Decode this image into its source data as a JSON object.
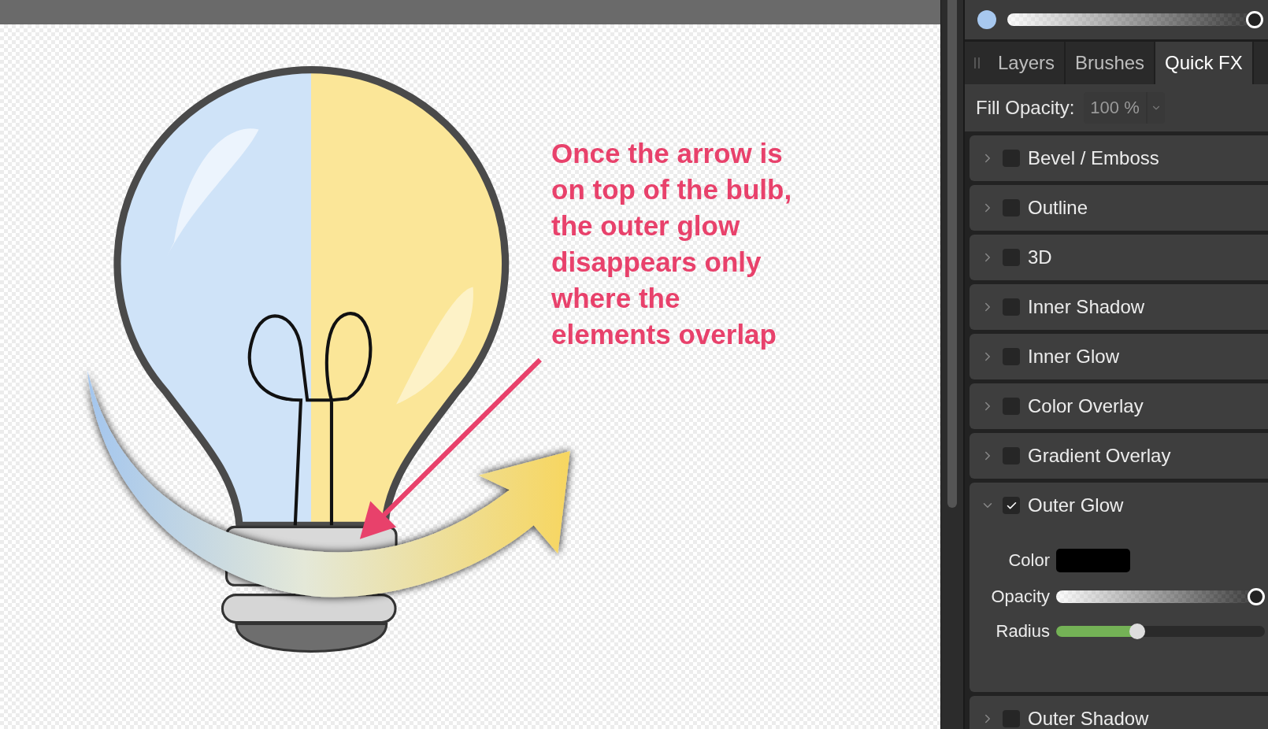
{
  "canvas": {
    "annotation": "Once the arrow is\non top of the bulb,\nthe outer glow\ndisappears only\nwhere the\nelements overlap"
  },
  "panel": {
    "opacity_slider": {
      "level": 1
    },
    "tabs": [
      {
        "label": "Layers",
        "selected": false
      },
      {
        "label": "Brushes",
        "selected": false
      },
      {
        "label": "Quick FX",
        "selected": true
      }
    ],
    "fill_opacity": {
      "label": "Fill Opacity:",
      "value": "100 %"
    },
    "effects": [
      {
        "label": "Bevel / Emboss",
        "checked": false,
        "expanded": false
      },
      {
        "label": "Outline",
        "checked": false,
        "expanded": false
      },
      {
        "label": "3D",
        "checked": false,
        "expanded": false
      },
      {
        "label": "Inner Shadow",
        "checked": false,
        "expanded": false
      },
      {
        "label": "Inner Glow",
        "checked": false,
        "expanded": false
      },
      {
        "label": "Color Overlay",
        "checked": false,
        "expanded": false
      },
      {
        "label": "Gradient Overlay",
        "checked": false,
        "expanded": false
      },
      {
        "label": "Outer Glow",
        "checked": true,
        "expanded": true,
        "settings": [
          {
            "kind": "color",
            "label": "Color",
            "color": "#000000"
          },
          {
            "kind": "alpha",
            "label": "Opacity",
            "level": 1
          },
          {
            "kind": "slider",
            "label": "Radius",
            "level": 0.39
          }
        ]
      },
      {
        "label": "Outer Shadow",
        "checked": false,
        "expanded": false
      }
    ]
  }
}
